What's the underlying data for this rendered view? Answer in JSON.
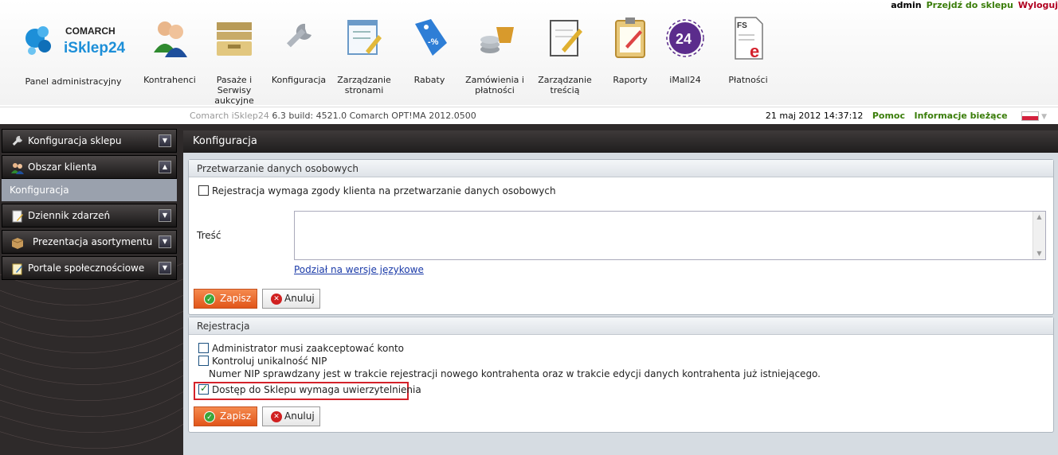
{
  "toplinks": {
    "user": "admin",
    "shop": "Przejdź do sklepu",
    "logout": "Wyloguj"
  },
  "logo": {
    "brand": "COMARCH",
    "product": "iSklep24",
    "label": "Panel administracyjny"
  },
  "toolbar": [
    {
      "label": "Kontrahenci",
      "icon": "users-icon"
    },
    {
      "label": "Pasaże i Serwisy aukcyjne",
      "icon": "folders-icon"
    },
    {
      "label": "Konfiguracja",
      "icon": "wrench-icon"
    },
    {
      "label": "Zarządzanie stronami",
      "icon": "page-edit-icon"
    },
    {
      "label": "Rabaty",
      "icon": "discount-tag-icon"
    },
    {
      "label": "Zamówienia i płatności",
      "icon": "basket-coins-icon"
    },
    {
      "label": "Zarządzanie treścią",
      "icon": "notebook-pen-icon"
    },
    {
      "label": "Raporty",
      "icon": "clipboard-icon"
    },
    {
      "label": "iMall24",
      "icon": "imall24-icon",
      "badge": "24"
    },
    {
      "label": "Płatności",
      "icon": "invoice-icon",
      "badge": "FS"
    }
  ],
  "buildbar": {
    "product": "Comarch iSklep24",
    "build": "6.3 build: 4521.0  Comarch OPT!MA 2012.0500",
    "datetime": "21 maj 2012 14:37:12",
    "help": "Pomoc",
    "news": "Informacje bieżące"
  },
  "sidebar": {
    "items": [
      {
        "label": "Konfiguracja sklepu",
        "icon": "wrench-icon"
      },
      {
        "label": "Obszar klienta",
        "icon": "users-icon"
      },
      {
        "label": "Dziennik zdarzeń",
        "icon": "notebook-icon"
      },
      {
        "label": "Prezentacja asortymentu",
        "icon": "box-icon"
      },
      {
        "label": "Portale społecznościowe",
        "icon": "note-pen-icon"
      }
    ],
    "active_sub": "Konfiguracja"
  },
  "main": {
    "title": "Konfiguracja",
    "panel1": {
      "title": "Przetwarzanie danych osobowych",
      "consent_checkbox": "Rejestracja wymaga zgody klienta na przetwarzanie danych osobowych",
      "content_label": "Treść",
      "content_value": "",
      "lang_link": "Podział na wersje językowe",
      "save": "Zapisz",
      "cancel": "Anuluj"
    },
    "panel2": {
      "title": "Rejestracja",
      "admin_accept": "Administrator musi zaakceptować konto",
      "nip_check": "Kontroluj unikalność NIP",
      "nip_hint": "Numer NIP sprawdzany jest w trakcie rejestracji nowego kontrahenta oraz w trakcie edycji danych kontrahenta już istniejącego.",
      "auth_required": "Dostęp do Sklepu wymaga uwierzytelnienia",
      "save": "Zapisz",
      "cancel": "Anuluj"
    }
  },
  "colors": {
    "accent_green": "#3a7d0a",
    "logout_red": "#b00020",
    "save_orange": "#e1551a",
    "highlight_red": "#d4222a"
  }
}
